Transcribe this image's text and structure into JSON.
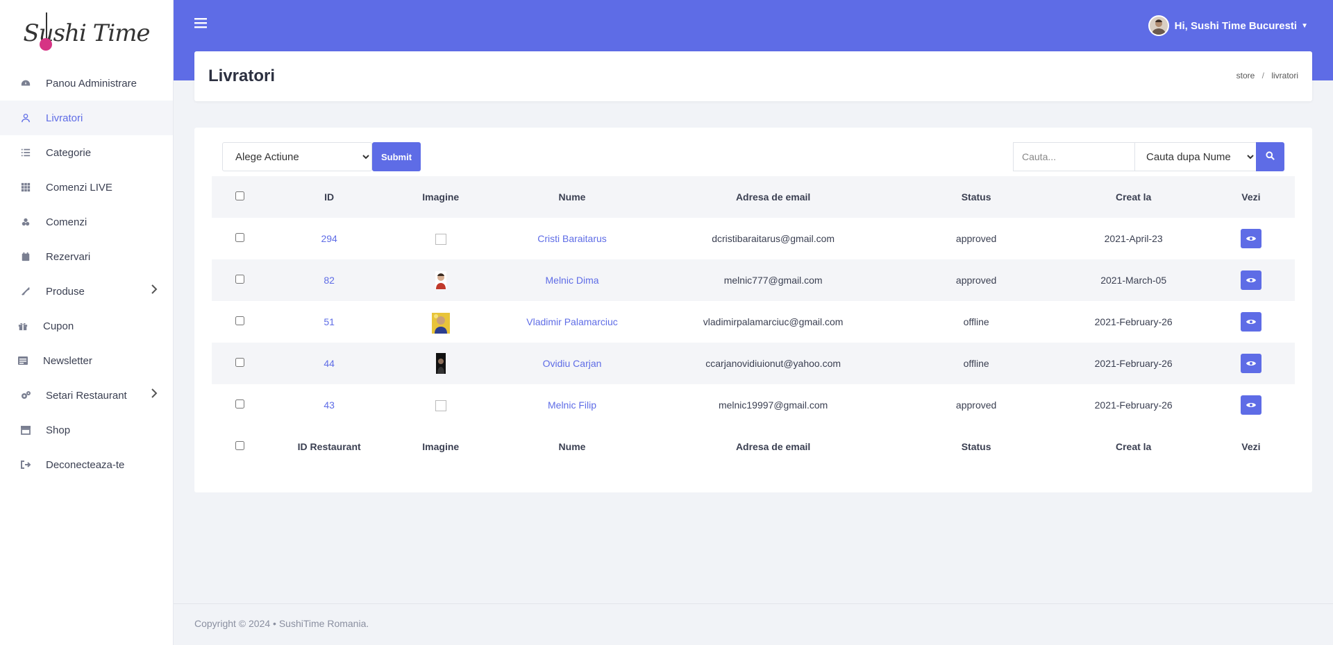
{
  "app": {
    "logo_text": "Sushi Time"
  },
  "sidebar": {
    "items": [
      {
        "label": "Panou Administrare",
        "icon": "dashboard-icon"
      },
      {
        "label": "Livratori",
        "icon": "user-icon",
        "active": true
      },
      {
        "label": "Categorie",
        "icon": "list-icon"
      },
      {
        "label": "Comenzi LIVE",
        "icon": "grid-icon"
      },
      {
        "label": "Comenzi",
        "icon": "orders-icon"
      },
      {
        "label": "Rezervari",
        "icon": "calendar-icon"
      },
      {
        "label": "Produse",
        "icon": "products-icon",
        "has_submenu": true
      },
      {
        "label": "Cupon",
        "icon": "gift-icon"
      },
      {
        "label": "Newsletter",
        "icon": "newsletter-icon"
      },
      {
        "label": "Setari Restaurant",
        "icon": "cogs-icon",
        "has_submenu": true
      },
      {
        "label": "Shop",
        "icon": "store-icon"
      },
      {
        "label": "Deconecteaza-te",
        "icon": "logout-icon"
      }
    ]
  },
  "header": {
    "user_greeting": "Hi, Sushi Time Bucuresti"
  },
  "page": {
    "title": "Livratori",
    "breadcrumb": [
      "store",
      "livratori"
    ]
  },
  "toolbar": {
    "action_select": "Alege Actiune",
    "submit_label": "Submit",
    "search_placeholder": "Cauta...",
    "search_by": "Cauta dupa Nume"
  },
  "table": {
    "headers": [
      "ID",
      "Imagine",
      "Nume",
      "Adresa de email",
      "Status",
      "Creat la",
      "Vezi"
    ],
    "footer_headers": [
      "ID Restaurant",
      "Imagine",
      "Nume",
      "Adresa de email",
      "Status",
      "Creat la",
      "Vezi"
    ],
    "rows": [
      {
        "id": "294",
        "name": "Cristi Baraitarus",
        "email": "dcristibaraitarus@gmail.com",
        "status": "approved",
        "created": "2021-April-23"
      },
      {
        "id": "82",
        "name": "Melnic Dima",
        "email": "melnic777@gmail.com",
        "status": "approved",
        "created": "2021-March-05"
      },
      {
        "id": "51",
        "name": "Vladimir Palamarciuc",
        "email": "vladimirpalamarciuc@gmail.com",
        "status": "offline",
        "created": "2021-February-26"
      },
      {
        "id": "44",
        "name": "Ovidiu Carjan",
        "email": "ccarjanovidiuionut@yahoo.com",
        "status": "offline",
        "created": "2021-February-26"
      },
      {
        "id": "43",
        "name": "Melnic Filip",
        "email": "melnic19997@gmail.com",
        "status": "approved",
        "created": "2021-February-26"
      }
    ]
  },
  "footer": {
    "text": "Copyright © 2024  •  SushiTime Romania."
  },
  "colors": {
    "accent": "#5e6ce6",
    "logo_dot": "#d63384"
  }
}
